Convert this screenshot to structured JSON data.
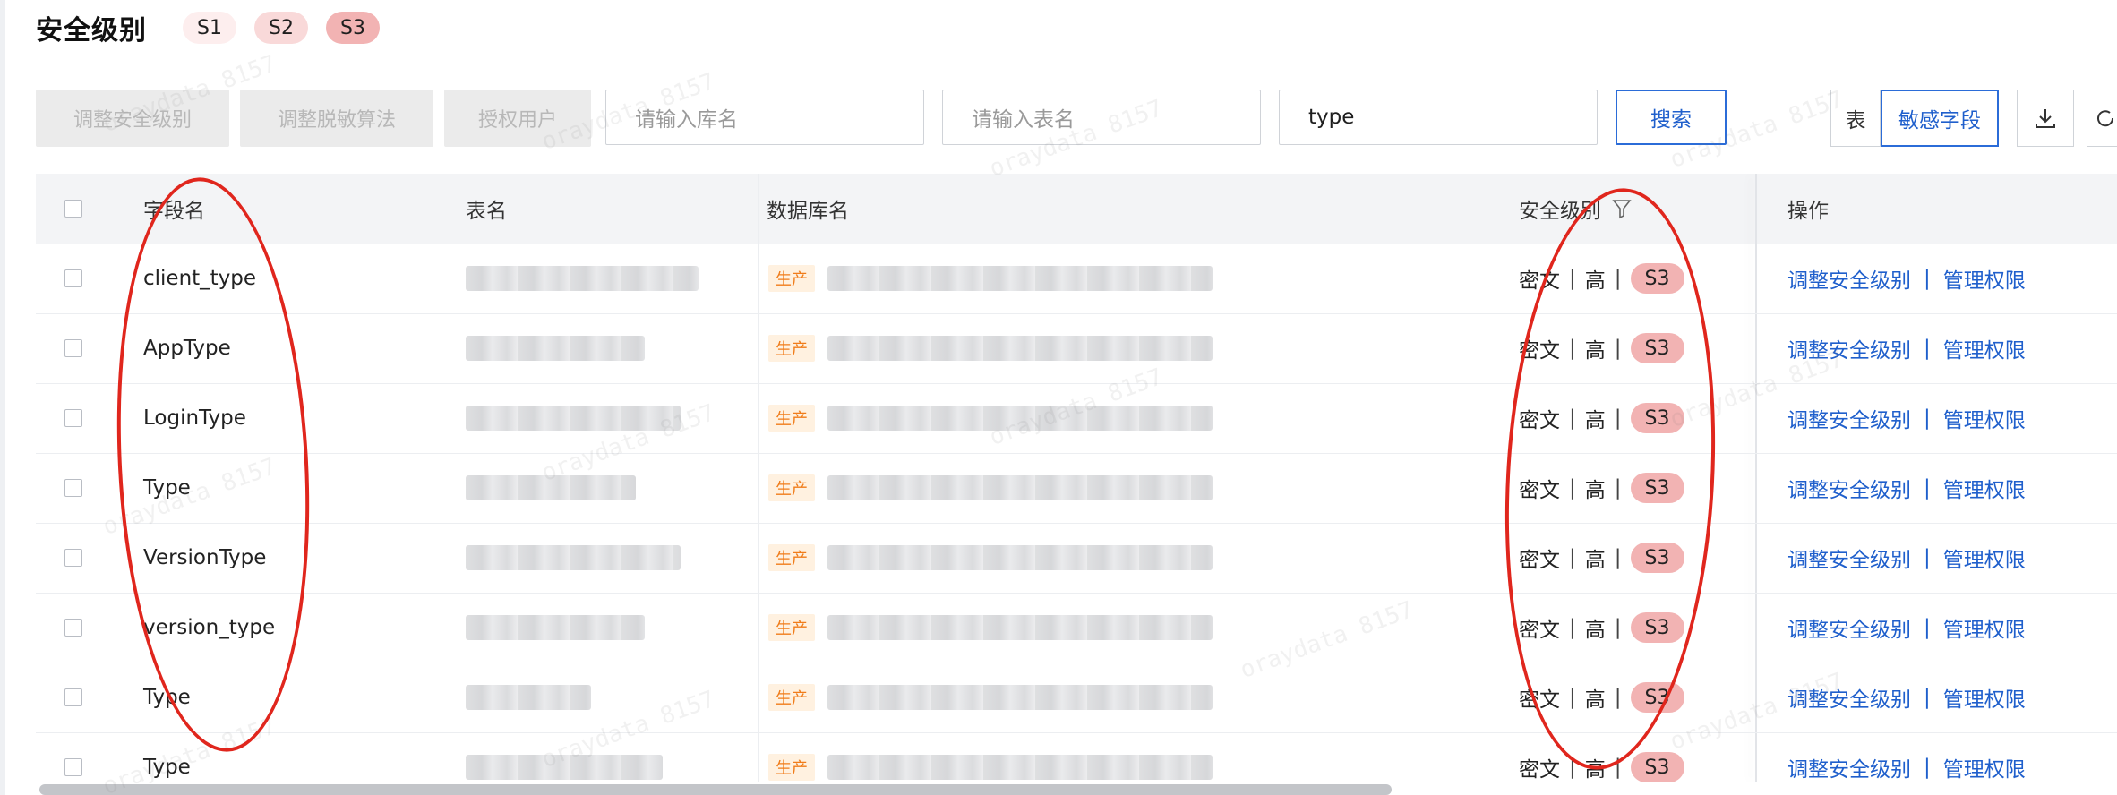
{
  "header": {
    "title": "安全级别",
    "levels": [
      "S1",
      "S2",
      "S3"
    ]
  },
  "toolbar": {
    "adjust_level_label": "调整安全级别",
    "adjust_algorithm_label": "调整脱敏算法",
    "authorize_label": "授权用户",
    "db_placeholder": "请输入库名",
    "table_placeholder": "请输入表名",
    "field_value": "type",
    "search_label": "搜索",
    "view_table_label": "表",
    "view_field_label": "敏感字段"
  },
  "table": {
    "columns": {
      "field": "字段名",
      "table": "表名",
      "database": "数据库名",
      "level": "安全级别",
      "ops": "操作"
    },
    "env_tag": "生产",
    "ops": {
      "adjust": "调整安全级别",
      "sep": "|",
      "manage": "管理权限"
    },
    "level_cell": {
      "cipher": "密文",
      "sep": "|",
      "high": "高",
      "badge": "S3"
    },
    "rows": [
      {
        "field": "client_type"
      },
      {
        "field": "AppType"
      },
      {
        "field": "LoginType"
      },
      {
        "field": "Type"
      },
      {
        "field": "VersionType"
      },
      {
        "field": "version_type"
      },
      {
        "field": "Type"
      },
      {
        "field": "Type"
      }
    ]
  },
  "watermark": "oraydata 8157",
  "colors": {
    "primary": "#1f5fcc",
    "s3": "#f2b3b3",
    "s2": "#f9d9d9",
    "s1": "#fdeeee",
    "env_tag_text": "#f07c1a",
    "annotation": "#e0261d"
  }
}
